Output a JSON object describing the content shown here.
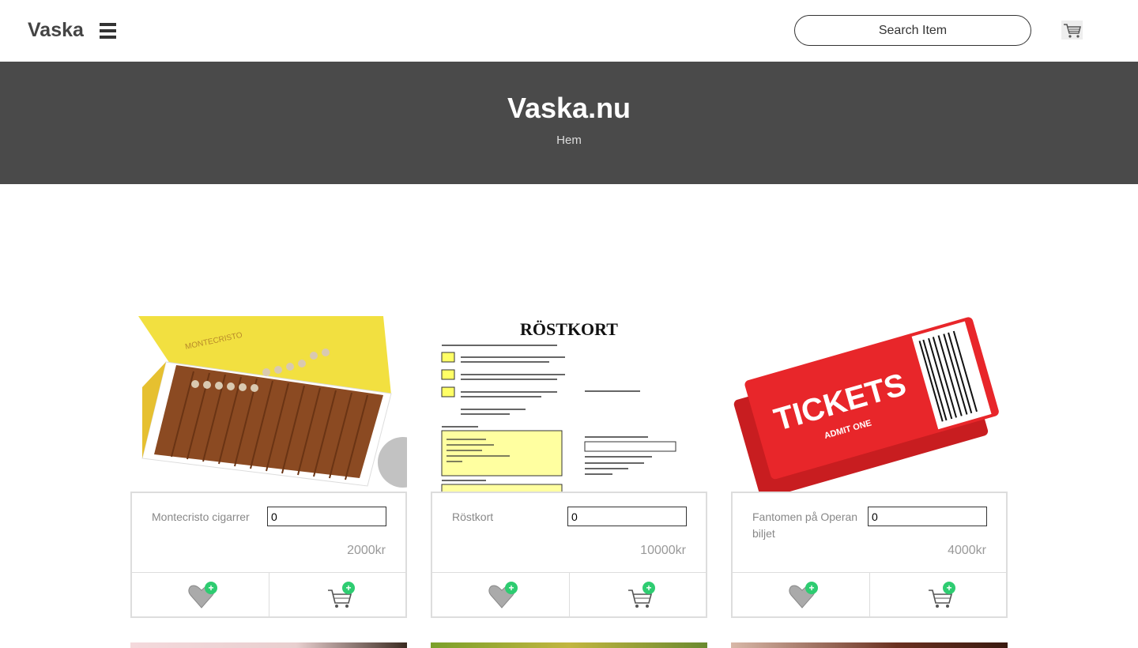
{
  "nav": {
    "brand": "Vaska",
    "search_placeholder": "Search Item"
  },
  "hero": {
    "title": "Vaska.nu",
    "breadcrumb": "Hem"
  },
  "products": [
    {
      "name": "Montecristo cigarrer",
      "qty": "0",
      "price": "2000kr"
    },
    {
      "name": "Röstkort",
      "qty": "0",
      "price": "10000kr",
      "image_title": "RÖSTKORT"
    },
    {
      "name": "Fantomen på Operan biljet",
      "qty": "0",
      "price": "4000kr",
      "image_title": "TICKETS",
      "image_subtitle": "ADMIT ONE"
    }
  ],
  "colors": {
    "hero_bg": "#4a4a4a",
    "plus_badge": "#2ecc71",
    "ticket_red": "#e8262a",
    "cigar_box_yellow": "#f2e040"
  }
}
